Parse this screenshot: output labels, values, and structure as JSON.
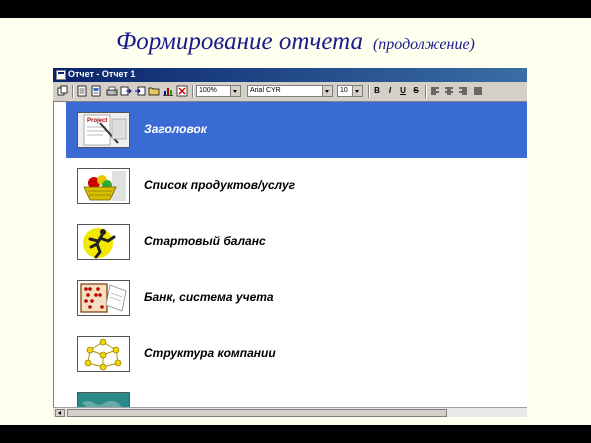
{
  "slide": {
    "title": "Формирование отчета",
    "subtitle": "(продолжение)"
  },
  "window": {
    "title": "Отчет - Отчет 1",
    "toolbar": {
      "zoom_value": "100%",
      "font_value": "Arial CYR",
      "size_value": "10",
      "bold_label": "B",
      "italic_label": "I",
      "underline_label": "U",
      "strike_label": "S"
    },
    "sections": [
      {
        "label": "Заголовок",
        "icon": "project-document-icon",
        "selected": true
      },
      {
        "label": "Список продуктов/услуг",
        "icon": "fruit-basket-icon",
        "selected": false
      },
      {
        "label": "Стартовый баланс",
        "icon": "runner-icon",
        "selected": false
      },
      {
        "label": "Банк, система учета",
        "icon": "abacus-icon",
        "selected": false
      },
      {
        "label": "Структура компании",
        "icon": "org-structure-icon",
        "selected": false
      }
    ]
  },
  "colors": {
    "selection": "#3a6bd4",
    "title_text": "#1a1a8c",
    "slide_bg": "#fffff0"
  }
}
